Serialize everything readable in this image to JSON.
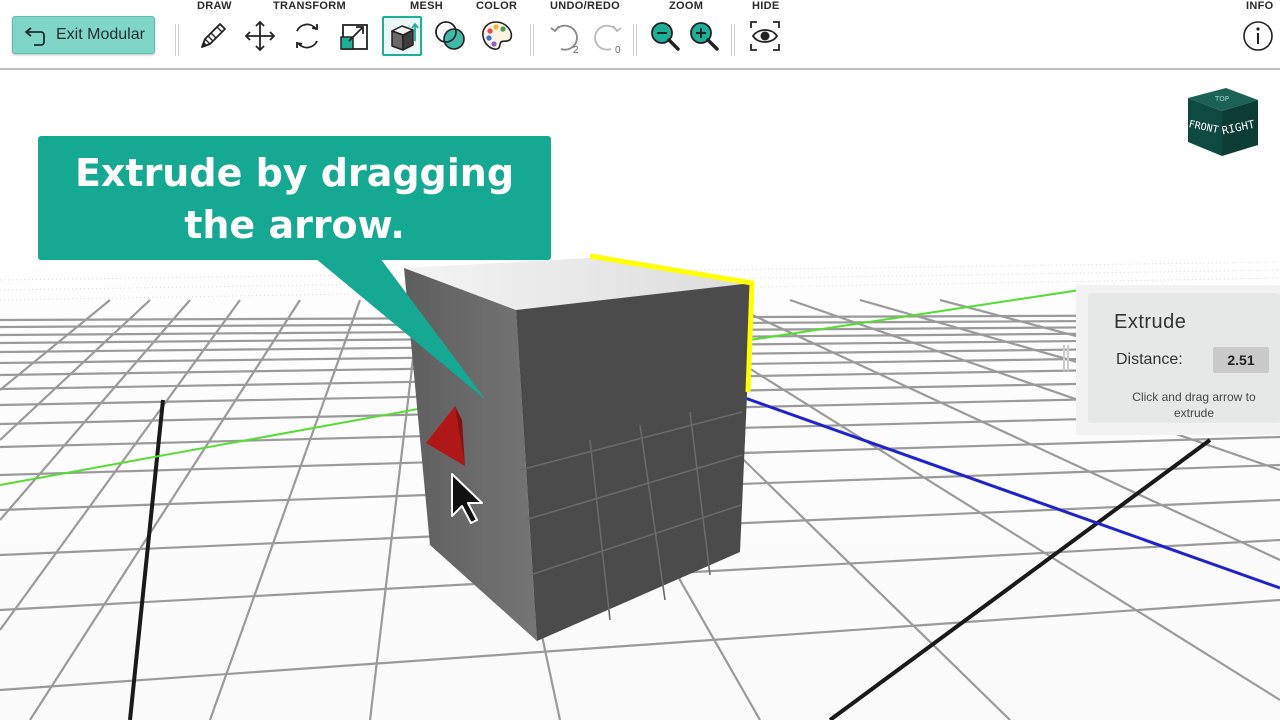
{
  "toolbar": {
    "exit_label": "Exit Modular",
    "groups": {
      "draw": "DRAW",
      "transform": "TRANSFORM",
      "mesh": "MESH",
      "color": "COLOR",
      "undo_redo": "UNDO/REDO",
      "zoom": "ZOOM",
      "hide": "HIDE",
      "info": "INFO"
    },
    "undo_count": "2",
    "redo_count": "0",
    "icons": [
      "pencil-icon",
      "move-arrows-icon",
      "rotate-icon",
      "scale-icon",
      "extrude-cube-icon",
      "boolean-circles-icon",
      "palette-icon",
      "undo-icon",
      "redo-icon",
      "zoom-out-icon",
      "zoom-in-icon",
      "eye-icon",
      "info-icon"
    ],
    "active_tool": "extrude-cube-icon"
  },
  "callout": {
    "line1": "Extrude by dragging",
    "line2": "the arrow."
  },
  "extrude_panel": {
    "title": "Extrude",
    "distance_label": "Distance:",
    "distance_value": "2.51",
    "hint": "Click and drag arrow to extrude"
  },
  "view_cube": {
    "front": "FRONT",
    "right": "RIGHT",
    "top": "TOP"
  },
  "colors": {
    "accent": "#15a892",
    "exit_button": "#7fd6c6",
    "cube_front": "#4b4b4b",
    "cube_side": "#5d5d5d",
    "cube_top": "#e8e8e8",
    "selected_edge": "#ffff00",
    "arrow": "#b01818",
    "x_axis": "#2222cc",
    "z_axis": "#55dd33"
  }
}
